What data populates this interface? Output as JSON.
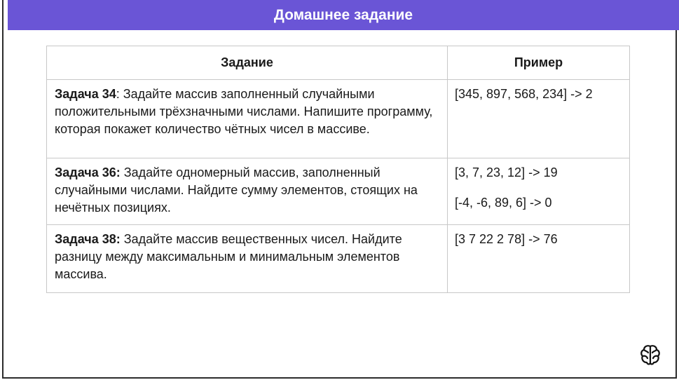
{
  "slide": {
    "title": "Домашнее задание"
  },
  "table": {
    "headers": [
      "Задание",
      "Пример"
    ],
    "rows": [
      {
        "label": "Задача 34",
        "sep": ":",
        "text": " Задайте массив заполненный случайными положительными трёхзначными числами. Напишите программу, которая покажет количество чётных чисел в массиве.",
        "examples": [
          "[345, 897, 568, 234] -> 2"
        ]
      },
      {
        "label": "Задача 36:",
        "sep": "",
        "text": " Задайте одномерный массив, заполненный случайными числами. Найдите сумму элементов, стоящих на нечётных позициях.",
        "examples": [
          "[3, 7, 23, 12] -> 19",
          "[-4, -6, 89, 6] -> 0"
        ]
      },
      {
        "label": "Задача 38:",
        "sep": "",
        "text": " Задайте массив вещественных чисел. Найдите разницу между максимальным и минимальным элементов массива.",
        "examples": [
          "[3 7 22 2 78] -> 76"
        ]
      }
    ]
  },
  "logo": {
    "icon": "brain-logo-icon"
  },
  "colors": {
    "banner": "#6a55d6",
    "border": "#c8c8c8"
  }
}
